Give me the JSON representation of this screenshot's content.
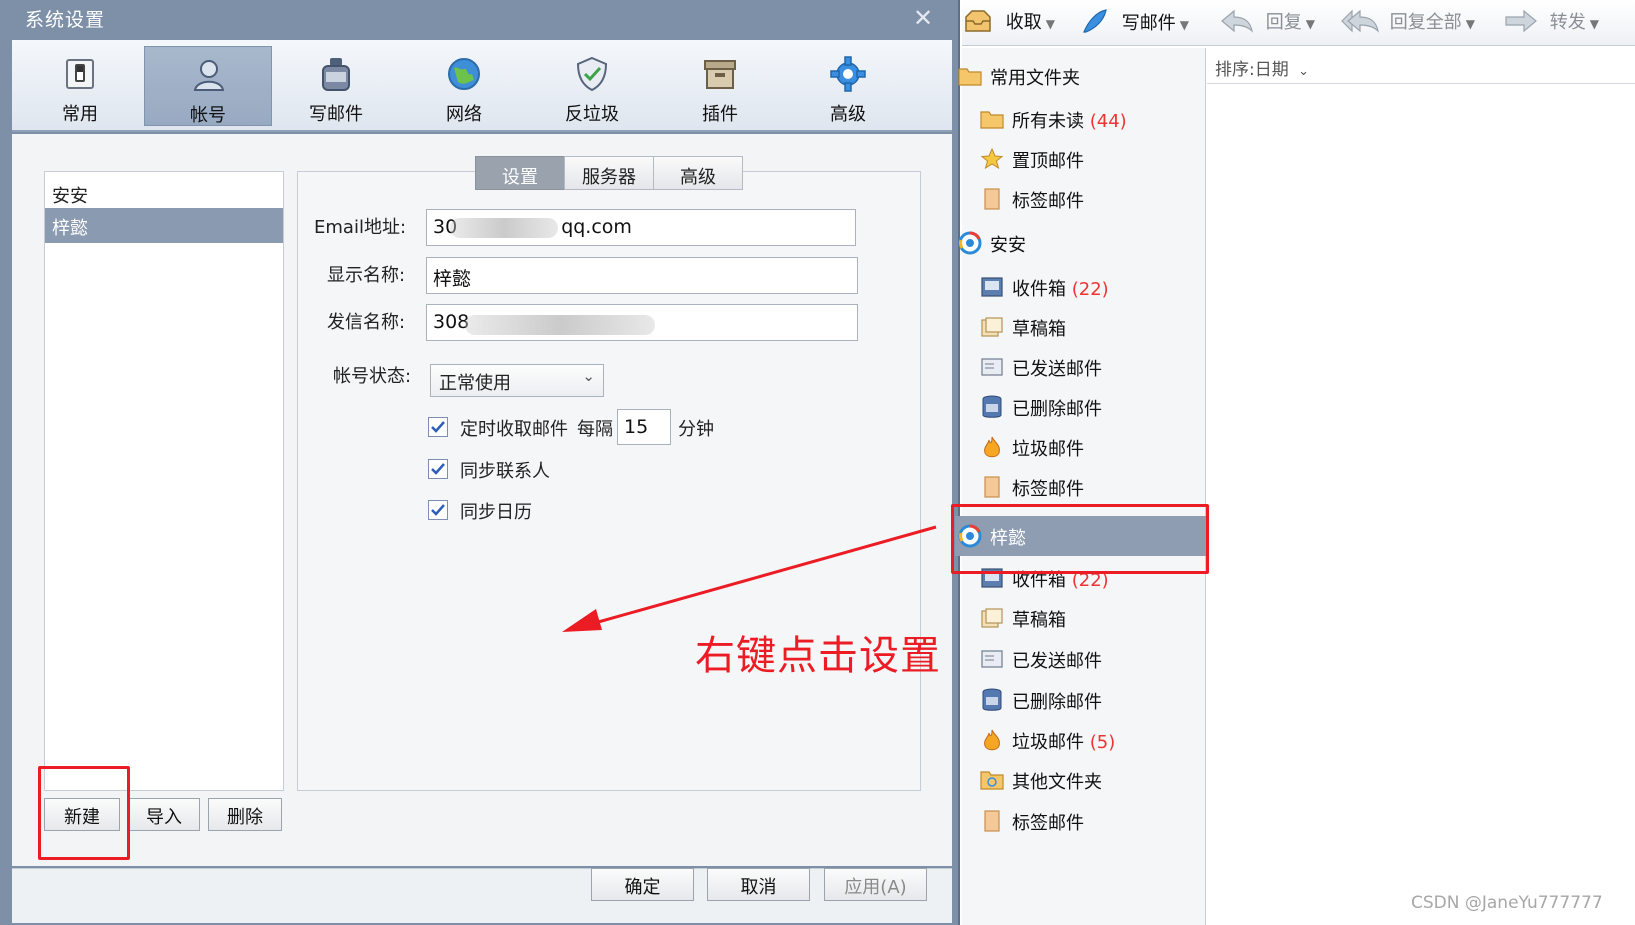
{
  "dialog": {
    "title": "系统设置",
    "close_glyph": "✕",
    "toolbar": [
      {
        "label": "常用",
        "icon": "switch-icon"
      },
      {
        "label": "帐号",
        "icon": "user-icon"
      },
      {
        "label": "写邮件",
        "icon": "ink-bottle-icon"
      },
      {
        "label": "网络",
        "icon": "globe-icon"
      },
      {
        "label": "反垃圾",
        "icon": "shield-icon"
      },
      {
        "label": "插件",
        "icon": "box-icon"
      },
      {
        "label": "高级",
        "icon": "gear-icon"
      }
    ],
    "active_toolbar": "帐号",
    "accounts": [
      "安安",
      "梓懿"
    ],
    "selected_account": "梓懿",
    "tabs": [
      "设置",
      "服务器",
      "高级"
    ],
    "active_tab": "设置",
    "fields": {
      "email_label": "Email地址:",
      "email_prefix": "30",
      "email_suffix": "qq.com",
      "display_label": "显示名称:",
      "display_value": "梓懿",
      "sender_label": "发信名称:",
      "sender_value": "308",
      "status_label": "帐号状态:",
      "status_value": "正常使用"
    },
    "options": {
      "auto_receive_label": "定时收取邮件",
      "interval_prefix": "每隔",
      "interval_value": "15",
      "interval_unit": "分钟",
      "sync_contacts": "同步联系人",
      "sync_calendar": "同步日历"
    },
    "list_buttons": {
      "new": "新建",
      "import": "导入",
      "delete": "删除"
    },
    "footer_buttons": {
      "ok": "确定",
      "cancel": "取消",
      "apply": "应用(A)"
    }
  },
  "main": {
    "toolbar": {
      "receive": "收取",
      "compose": "写邮件",
      "reply": "回复",
      "reply_all": "回复全部",
      "forward": "转发"
    },
    "sort_label": "排序:日期",
    "folders": {
      "common_header": "常用文件夹",
      "all_unread": "所有未读",
      "all_unread_count": "(44)",
      "pinned": "置顶邮件",
      "tagged": "标签邮件",
      "account1": "安安",
      "account2": "梓懿",
      "inbox": "收件箱",
      "inbox_count": "(22)",
      "drafts": "草稿箱",
      "sent": "已发送邮件",
      "deleted": "已删除邮件",
      "junk": "垃圾邮件",
      "junk_count2": "(5)",
      "other": "其他文件夹"
    }
  },
  "annotation": {
    "text": "右键点击设置",
    "color": "#ec1c24"
  },
  "watermark": "CSDN @JaneYu777777"
}
